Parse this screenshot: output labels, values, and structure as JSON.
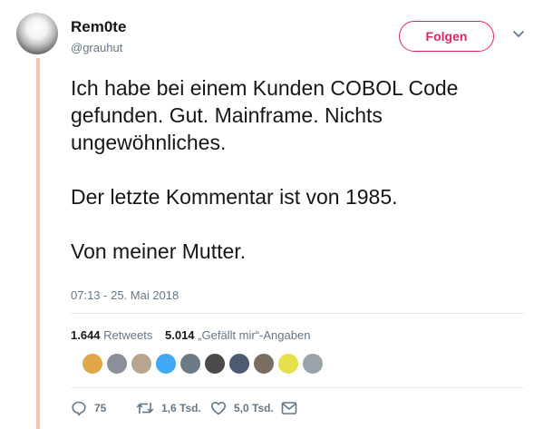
{
  "user": {
    "display_name": "Rem0te",
    "handle": "@grauhut"
  },
  "follow_label": "Folgen",
  "tweet": {
    "paragraphs": [
      "Ich habe bei einem Kunden COBOL Code gefunden. Gut. Mainframe. Nichts ungewöhnliches.",
      "Der letzte Kommentar ist von 1985.",
      "Von meiner Mutter."
    ],
    "timestamp": "07:13 - 25. Mai 2018"
  },
  "stats": {
    "retweets_count": "1.644",
    "retweets_label": "Retweets",
    "likes_count": "5.014",
    "likes_label": "„Gefällt mir“-Angaben"
  },
  "likers": [
    {
      "icon": "liker-avatar-1",
      "color": "#e0a64a"
    },
    {
      "icon": "liker-avatar-2",
      "color": "#8a8f99"
    },
    {
      "icon": "liker-avatar-3",
      "color": "#b7a58e"
    },
    {
      "icon": "liker-avatar-4",
      "color": "#3fa9f5"
    },
    {
      "icon": "liker-avatar-5",
      "color": "#6b7a86"
    },
    {
      "icon": "liker-avatar-6",
      "color": "#4a4a4a"
    },
    {
      "icon": "liker-avatar-7",
      "color": "#4c5a73"
    },
    {
      "icon": "liker-avatar-8",
      "color": "#7a6e63"
    },
    {
      "icon": "liker-avatar-9",
      "color": "#e6e04a"
    },
    {
      "icon": "liker-avatar-10",
      "color": "#9aa3a8"
    }
  ],
  "actions": {
    "reply_count": "75",
    "retweet_count": "1,6 Tsd.",
    "like_count": "5,0 Tsd."
  },
  "colors": {
    "accent": "#e0245e",
    "thread_line": "#f5c6ae",
    "secondary_text": "#657786",
    "primary_text": "#14171a"
  }
}
